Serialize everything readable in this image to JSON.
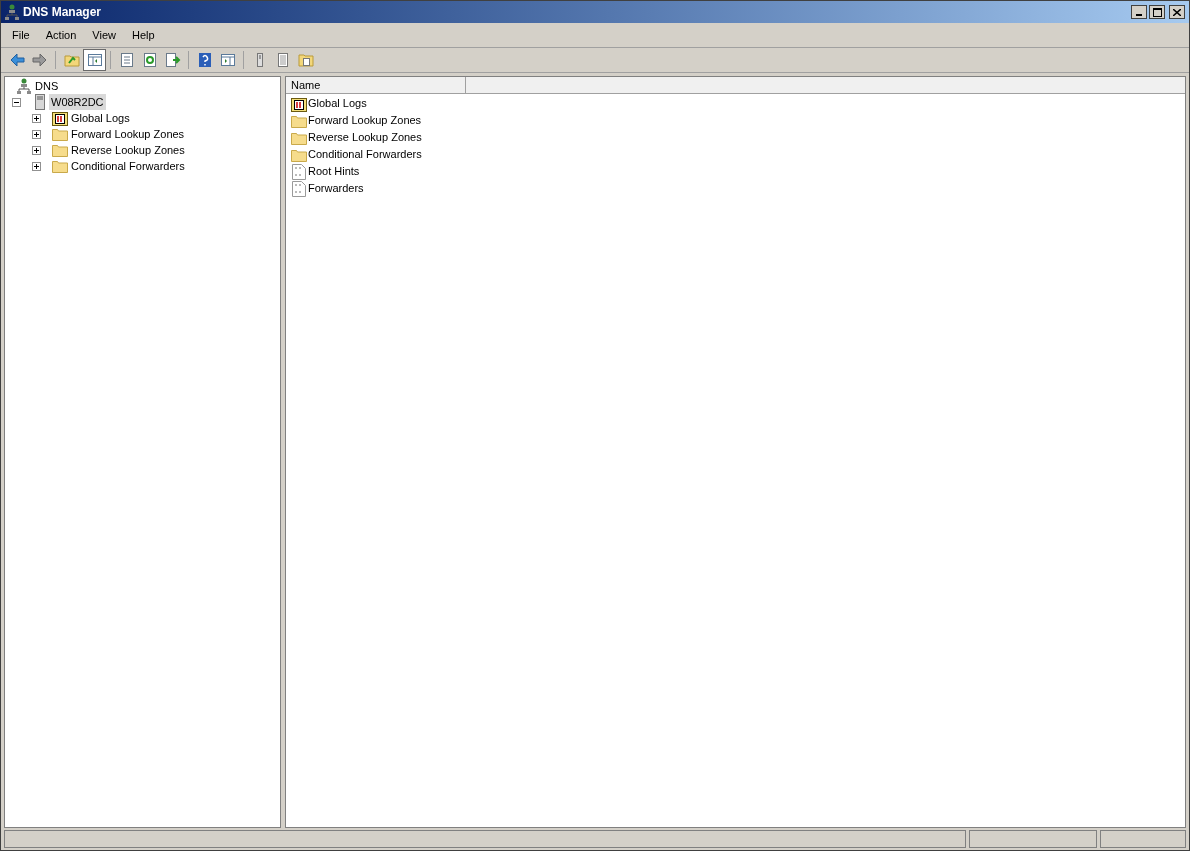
{
  "window": {
    "title": "DNS Manager"
  },
  "menu": [
    "File",
    "Action",
    "View",
    "Help"
  ],
  "toolbar": [
    {
      "kind": "back",
      "pressed": false
    },
    {
      "kind": "forward",
      "pressed": false
    },
    {
      "kind": "sep"
    },
    {
      "kind": "up",
      "pressed": false
    },
    {
      "kind": "tree",
      "pressed": true
    },
    {
      "kind": "sep"
    },
    {
      "kind": "props",
      "pressed": false
    },
    {
      "kind": "refresh",
      "pressed": false
    },
    {
      "kind": "export",
      "pressed": false
    },
    {
      "kind": "sep"
    },
    {
      "kind": "help",
      "pressed": false
    },
    {
      "kind": "action",
      "pressed": false
    },
    {
      "kind": "sep"
    },
    {
      "kind": "server",
      "pressed": false
    },
    {
      "kind": "list",
      "pressed": false
    },
    {
      "kind": "folderdoc",
      "pressed": false
    }
  ],
  "tree": {
    "label": "DNS",
    "kind": "dns",
    "children": [
      {
        "label": "W08R2DC",
        "kind": "server",
        "expanded": true,
        "selected": true,
        "children": [
          {
            "label": "Global Logs",
            "kind": "log",
            "expanded": false,
            "selected": false
          },
          {
            "label": "Forward Lookup Zones",
            "kind": "folder",
            "expanded": false,
            "selected": false
          },
          {
            "label": "Reverse Lookup Zones",
            "kind": "folder",
            "expanded": false,
            "selected": false
          },
          {
            "label": "Conditional Forwarders",
            "kind": "folder",
            "expanded": false,
            "selected": false
          }
        ]
      }
    ]
  },
  "list": {
    "columns": [
      "Name"
    ],
    "rows": [
      {
        "name": "Global Logs",
        "kind": "log"
      },
      {
        "name": "Forward Lookup Zones",
        "kind": "folder"
      },
      {
        "name": "Reverse Lookup Zones",
        "kind": "folder"
      },
      {
        "name": "Conditional Forwarders",
        "kind": "folder"
      },
      {
        "name": "Root Hints",
        "kind": "file"
      },
      {
        "name": "Forwarders",
        "kind": "file"
      }
    ]
  }
}
